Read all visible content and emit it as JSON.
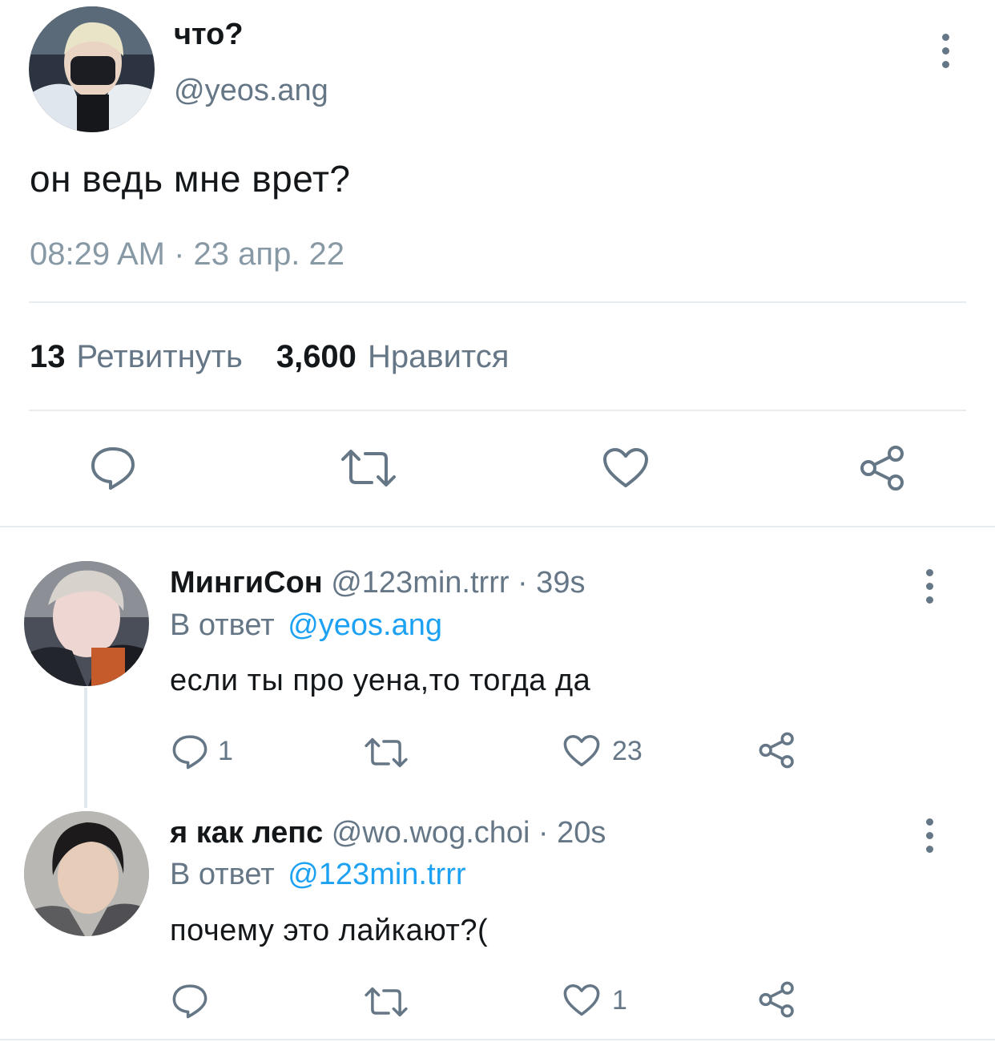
{
  "main_tweet": {
    "author_name": "что?",
    "author_handle": "@yeos.ang",
    "text": "он ведь мне врет?",
    "timestamp": "08:29 AM · 23 апр. 22",
    "retweets_count": "13",
    "retweets_label": "Ретвитнуть",
    "likes_count": "3,600",
    "likes_label": "Нравится"
  },
  "replies": [
    {
      "author_name": "МингиСон",
      "author_handle": "@123min.trrr",
      "time": "· 39s",
      "reply_prefix": "В ответ",
      "reply_to": "@yeos.ang",
      "text": "если ты про уена,то тогда да",
      "reply_count": "1",
      "like_count": "23"
    },
    {
      "author_name": "я как лепс",
      "author_handle": "@wo.wog.choi",
      "time": "· 20s",
      "reply_prefix": "В ответ",
      "reply_to": "@123min.trrr",
      "text": "почему это лайкают?(",
      "reply_count": "",
      "like_count": "1"
    }
  ],
  "colors": {
    "text": "#14171a",
    "secondary": "#657786",
    "link": "#1da1f2",
    "divider": "#e6ecf0"
  },
  "icons": [
    "comment-icon",
    "retweet-icon",
    "heart-icon",
    "share-icon",
    "more-icon"
  ]
}
